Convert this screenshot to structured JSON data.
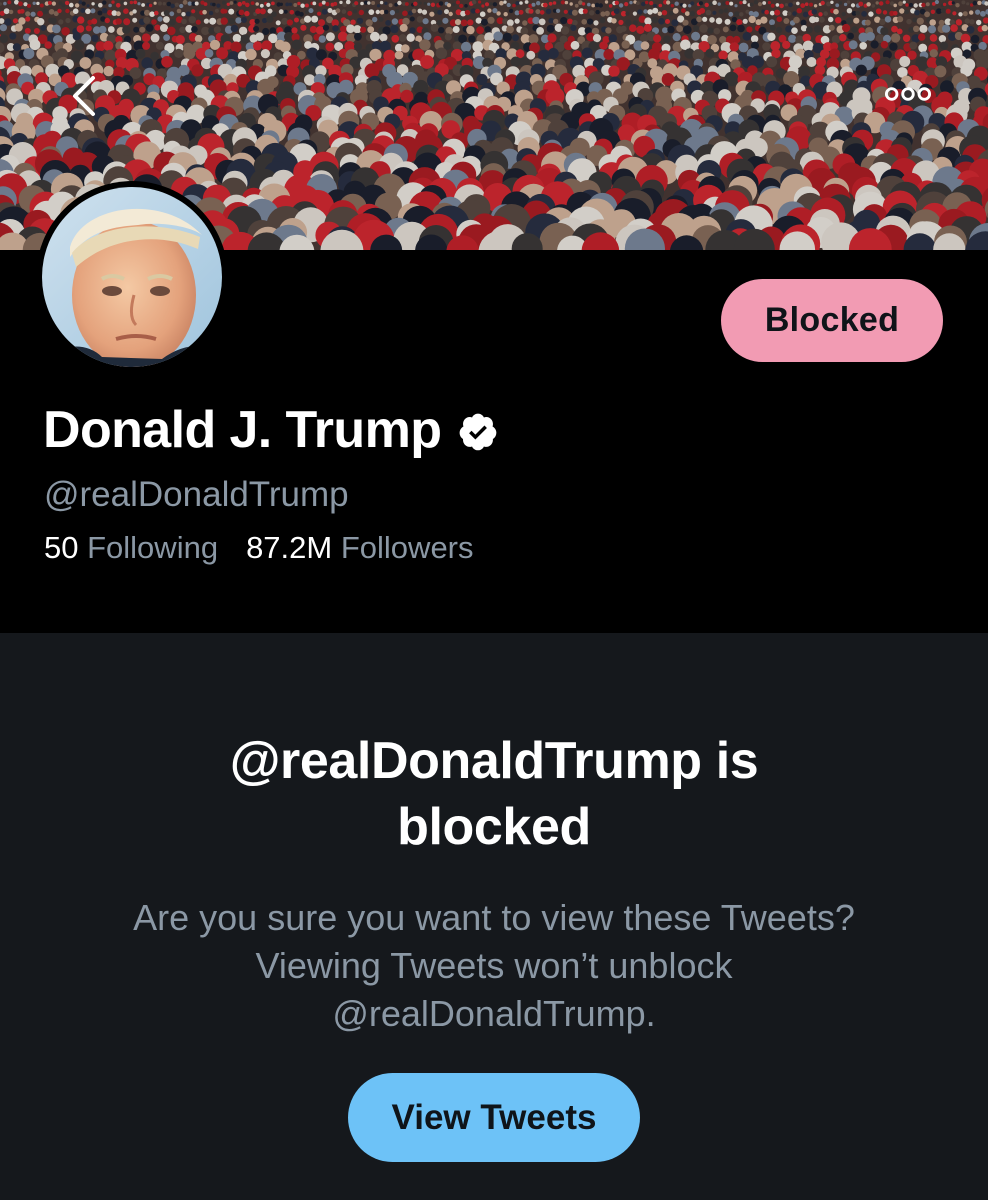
{
  "header": {
    "back_icon": "chevron-left-icon",
    "more_icon": "more-horizontal-icon"
  },
  "profile": {
    "display_name": "Donald J. Trump",
    "verified_icon": "verified-badge-icon",
    "handle": "@realDonaldTrump",
    "block_button_label": "Blocked",
    "block_button_color": "#f29bb3",
    "following_count": "50",
    "following_label": "Following",
    "followers_count": "87.2M",
    "followers_label": "Followers"
  },
  "blocked_notice": {
    "title_line1": "@realDonaldTrump is",
    "title_line2": "blocked",
    "body_line1": "Are you sure you want to view these Tweets?",
    "body_line2": "Viewing Tweets won’t unblock",
    "body_line3": "@realDonaldTrump.",
    "view_button_label": "View Tweets",
    "view_button_color": "#6dc2f7"
  }
}
